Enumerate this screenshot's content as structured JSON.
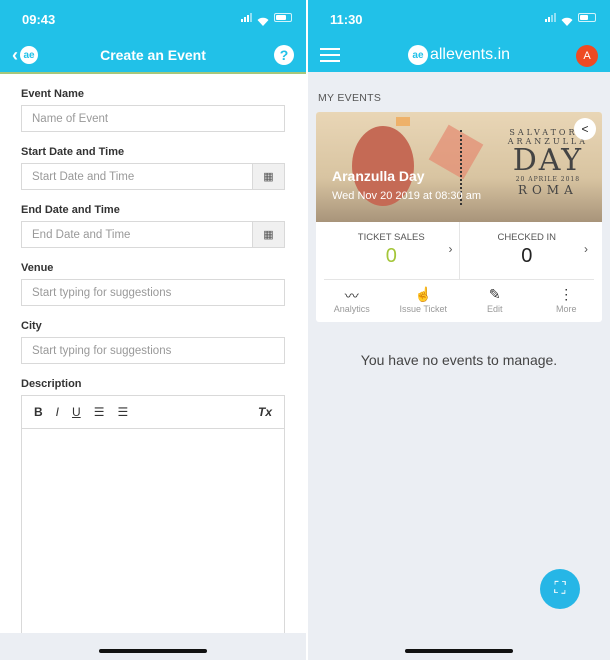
{
  "left": {
    "status_time": "09:43",
    "title": "Create an Event",
    "logo_glyph": "ae",
    "help_glyph": "?",
    "fields": [
      {
        "label": "Event Name",
        "placeholder": "Name of Event"
      },
      {
        "label": "Start Date and Time",
        "placeholder": "Start Date and Time"
      },
      {
        "label": "End Date and Time",
        "placeholder": "End Date and Time"
      },
      {
        "label": "Venue",
        "placeholder": "Start typing for suggestions"
      },
      {
        "label": "City",
        "placeholder": "Start typing for suggestions"
      }
    ],
    "description_label": "Description",
    "toolbar": {
      "bold": "B",
      "italic": "I",
      "underline": "U",
      "ordered_list": "☰",
      "bullet_list": "☰",
      "clear_format": "Tx"
    },
    "calendar_glyph": "▦"
  },
  "right": {
    "status_time": "11:30",
    "brand": "allevents.in",
    "logo_glyph": "ae",
    "avatar_initial": "A",
    "section_title": "MY EVENTS",
    "event": {
      "name": "Aranzulla Day",
      "date": "Wed Nov 20 2019 at 08:30 am",
      "poster": {
        "line1": "SALVATORE",
        "line2": "ARANZULLA",
        "line3": "DAY",
        "line4": "20 APRILE 2018",
        "line5": "ROMA"
      }
    },
    "stats": [
      {
        "label": "TICKET SALES",
        "value": "0",
        "color": "#a4c639"
      },
      {
        "label": "CHECKED IN",
        "value": "0",
        "color": "#222222"
      }
    ],
    "actions": [
      {
        "label": "Analytics",
        "icon": "〰"
      },
      {
        "label": "Issue Ticket",
        "icon": "☝"
      },
      {
        "label": "Edit",
        "icon": "✎"
      },
      {
        "label": "More",
        "icon": "⋮"
      }
    ],
    "empty_message": "You have no events to manage.",
    "fab_icon": "⛶",
    "share_icon": "<"
  },
  "colors": {
    "primary": "#21c1e8",
    "accent_bar": "#a6c77b",
    "avatar": "#ee4a23"
  }
}
